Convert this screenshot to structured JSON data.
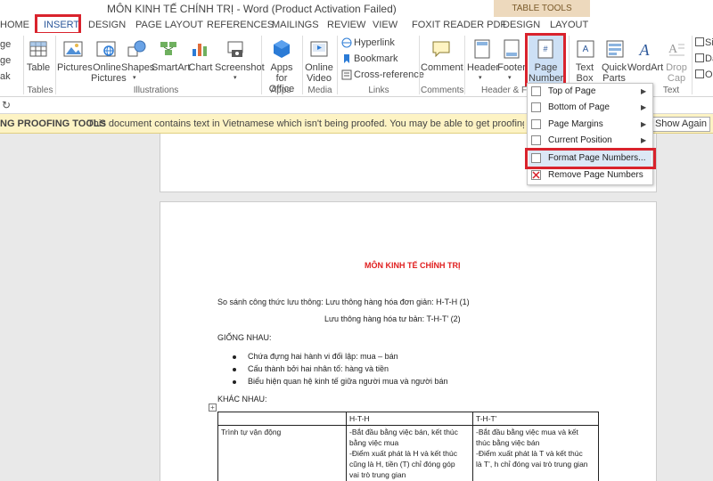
{
  "window": {
    "title": "MÔN KINH TẾ CHÍNH TRỊ - Word (Product Activation Failed)",
    "context_tab_group": "TABLE TOOLS"
  },
  "tabs": [
    "HOME",
    "INSERT",
    "DESIGN",
    "PAGE LAYOUT",
    "REFERENCES",
    "MAILINGS",
    "REVIEW",
    "VIEW",
    "FOXIT READER PDF",
    "DESIGN",
    "LAYOUT"
  ],
  "ribbon": {
    "left_partial": [
      "ge",
      "ge",
      "ak"
    ],
    "table": "Table",
    "pictures": "Pictures",
    "online_pictures": [
      "Online",
      "Pictures"
    ],
    "shapes": "Shapes",
    "smartart": "SmartArt",
    "chart": "Chart",
    "screenshot": "Screenshot",
    "apps_office": [
      "Apps for",
      "Office"
    ],
    "online_video": [
      "Online",
      "Video"
    ],
    "hyperlink": "Hyperlink",
    "bookmark": "Bookmark",
    "cross_reference": "Cross-reference",
    "comment": "Comment",
    "header": "Header",
    "footer": "Footer",
    "page_number": [
      "Page",
      "Number"
    ],
    "text_box": [
      "Text",
      "Box"
    ],
    "quick_parts": [
      "Quick",
      "Parts"
    ],
    "wordart": "WordArt",
    "drop_cap": [
      "Drop",
      "Cap"
    ],
    "right_partial": [
      "Si",
      "Da",
      "Ob"
    ],
    "groups": [
      "Tables",
      "Illustrations",
      "Apps",
      "Media",
      "Links",
      "Comments",
      "Header & F",
      "Text"
    ]
  },
  "message_bar": {
    "title": "NG PROOFING TOOLS",
    "text": "This document contains text in Vietnamese which isn't being proofed. You may be able to get proofing tools for this langu",
    "button": "Show Again"
  },
  "menu": [
    "Top of Page",
    "Bottom of Page",
    "Page Margins",
    "Current Position",
    "Format Page Numbers...",
    "Remove Page Numbers"
  ],
  "document": {
    "heading": "MÔN KINH TẾ CHÍNH TRỊ",
    "line1": "So sánh công thức lưu thông: Lưu thông hàng hóa đơn giản: H-T-H (1)",
    "line2": "Lưu thông hàng hóa tư bản: T-H-T’  (2)",
    "same_title": "GIỐNG NHAU:",
    "bullets": [
      "Chứa đựng hai hành vi đối lập: mua – bán",
      "Cấu thành bởi hai nhân tố: hàng và tiền",
      "Biểu hiện quan hệ kinh tế giữa người mua và người bán"
    ],
    "diff_title": "KHÁC NHAU:",
    "table": {
      "headers": [
        "",
        "H-T-H",
        "T-H-T’"
      ],
      "row_label": "Trình tự vận động",
      "col1_lines": [
        "-Bắt đầu bằng việc bán, kết thúc",
        "bằng việc mua",
        "-Điểm xuất phát là H và kết thúc",
        "cũng là H, tiền (T) chỉ đóng góp",
        "vai trò trung gian"
      ],
      "col2_lines": [
        "-Bắt đầu bằng việc mua và kết",
        "thúc bằng việc bán",
        "-Điểm xuất phát là T và kết thúc",
        "là T’, h chỉ đóng vai trò trung gian"
      ]
    }
  }
}
